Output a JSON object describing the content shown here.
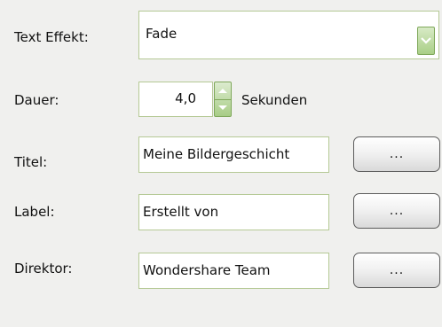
{
  "fields": {
    "text_effect": {
      "label": "Text Effekt:",
      "value": "Fade"
    },
    "duration": {
      "label": "Dauer:",
      "value": "4,0",
      "unit": "Sekunden"
    },
    "title": {
      "label": "Titel:",
      "value": "Meine Bildergeschicht",
      "button": "..."
    },
    "label": {
      "label": "Label:",
      "value": "Erstellt von",
      "button": "..."
    },
    "director": {
      "label": "Direktor:",
      "value": "Wondershare Team",
      "button": "..."
    }
  },
  "icons": {
    "dropdown": "chevron-down-icon",
    "spin_up": "triangle-up-icon",
    "spin_down": "triangle-down-icon"
  },
  "colors": {
    "background": "#f0f0ee",
    "field_border": "#b5c995",
    "accent_green": "#a9cf86"
  }
}
